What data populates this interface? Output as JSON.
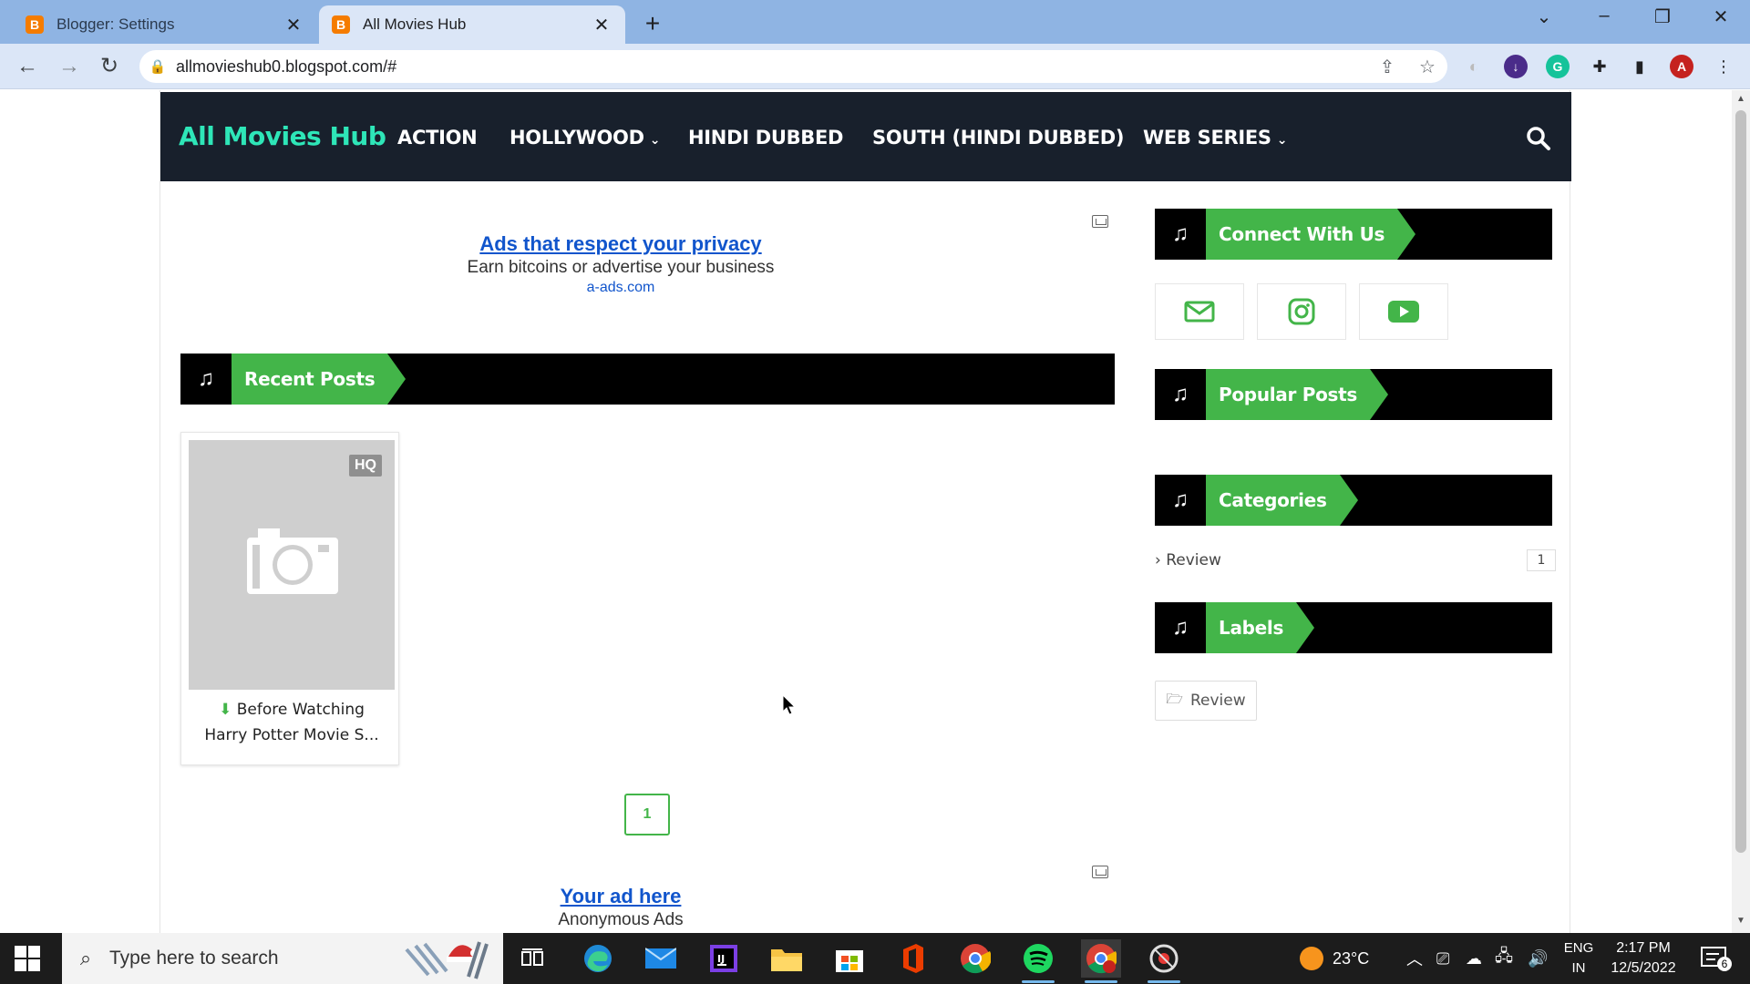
{
  "browser": {
    "tabs": [
      {
        "title": "Blogger: Settings",
        "favicon": "B",
        "active": false
      },
      {
        "title": "All Movies Hub",
        "favicon": "B",
        "active": true
      }
    ],
    "url": "allmovieshub0.blogspot.com/#",
    "profile_initial": "A"
  },
  "site": {
    "brand": "All Movies Hub",
    "menu": [
      {
        "label": "ACTION",
        "dropdown": false
      },
      {
        "label": "HOLLYWOOD",
        "dropdown": true
      },
      {
        "label": "HINDI DUBBED",
        "dropdown": false
      },
      {
        "label": "SOUTH (HINDI DUBBED)",
        "dropdown": false
      },
      {
        "label": "WEB SERIES",
        "dropdown": true
      }
    ],
    "brand_color": "#2ee6b8",
    "accent_color": "#43b549",
    "nav_bg": "#18202c"
  },
  "top_ad": {
    "title": "Ads that respect your privacy",
    "text": "Earn bitcoins or advertise your business",
    "link": "a-ads.com"
  },
  "recent_posts": {
    "heading": "Recent Posts",
    "posts": [
      {
        "badge": "HQ",
        "title_line1": "Before Watching",
        "title_line2": "Harry Potter Movie S..."
      }
    ],
    "pager": "1"
  },
  "bottom_ad": {
    "title": "Your ad here",
    "text": "Anonymous Ads"
  },
  "sidebar": {
    "connect_heading": "Connect With Us",
    "social_icons": [
      "mail-icon",
      "instagram-icon",
      "youtube-icon"
    ],
    "popular_heading": "Popular Posts",
    "categories_heading": "Categories",
    "categories": [
      {
        "name": "Review",
        "count": "1"
      }
    ],
    "labels_heading": "Labels",
    "labels": [
      "Review"
    ]
  },
  "taskbar": {
    "search_placeholder": "Type here to search",
    "weather": "23°C",
    "lang_line1": "ENG",
    "lang_line2": "IN",
    "time": "2:17 PM",
    "date": "12/5/2022",
    "notifications": "6"
  }
}
